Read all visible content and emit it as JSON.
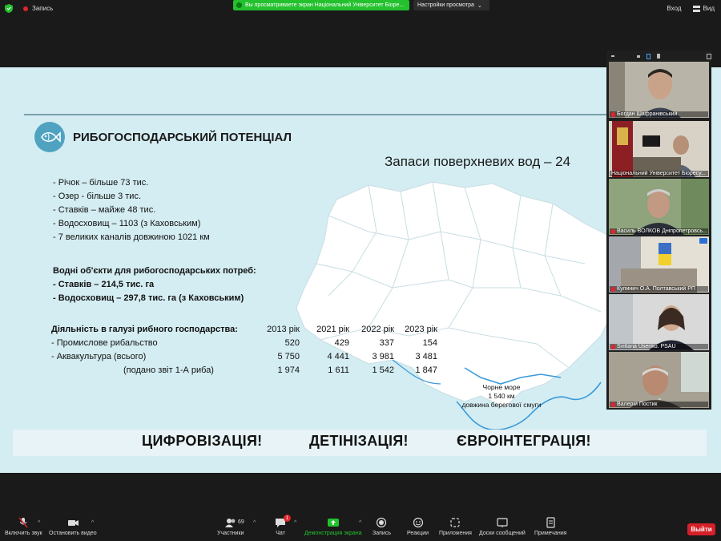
{
  "topbar": {
    "record_label": "Запись",
    "share_banner": "Вы просматриваете экран Національний Університет Біоре...",
    "view_options": "Настройки просмотра",
    "enter_label": "Вход",
    "view_label": "Вид"
  },
  "slide": {
    "title": "РИБОГОСПОДАРСЬКИЙ ПОТЕНЦІАЛ",
    "map_title": "Запаси поверхневих вод – 24",
    "stats": [
      "-  Річок – більше 73 тис.",
      "-  Озер -  більше 3 тис.",
      "-  Ставків – майже 48 тис.",
      "-  Водосховищ – 1103 (з Каховським)",
      "-  7 великих каналів довжиною 1021 км"
    ],
    "water_objects": {
      "heading": "Водні об'єкти для рибогосподарських потреб:",
      "items": [
        "- Ставків – 214,5 тис. га",
        "- Водосховищ – 297,8 тис. га (з Каховським)"
      ]
    },
    "activity": {
      "heading": "Діяльність в галузі рибного господарства:",
      "years": [
        "2013 рік",
        "2021 рік",
        "2022 рік",
        "2023 рік"
      ],
      "rows": [
        {
          "label": "-  Промислове рибальство",
          "values": [
            "520",
            "429",
            "337",
            "154"
          ]
        },
        {
          "label": "- Аквакультура (всього)",
          "values": [
            "5 750",
            "4 441",
            "3 981",
            "3 481"
          ]
        },
        {
          "label": "(подано звіт 1-А риба)",
          "values": [
            "1 974",
            "1 611",
            "1 542",
            "1 847"
          ]
        }
      ]
    },
    "sea_label": {
      "line1": "Чорне море",
      "line2": "1 540 км",
      "line3": "довжина берегової смуги"
    },
    "slogans": [
      "ЦИФРОВІЗАЦІЯ!",
      "ДЕТІНІЗАЦІЯ!",
      "ЄВРОІНТЕГРАЦІЯ!"
    ]
  },
  "participants": [
    {
      "name": "Богдан Шафранівський"
    },
    {
      "name": "Національний Університет Біоресу..."
    },
    {
      "name": "Василь ВОЛКОВ Дніпропетровсь..."
    },
    {
      "name": "Кулинич О.А. Полтавський РП"
    },
    {
      "name": "Svitlana Usenko. PSAU"
    },
    {
      "name": "Валерій Постик"
    }
  ],
  "toolbar": {
    "unmute": "Включить звук",
    "stop_video": "Остановить видео",
    "participants": "Участники",
    "participants_count": "69",
    "chat": "Чат",
    "chat_badge": "1",
    "share_screen": "Демонстрация экрана",
    "record": "Запись",
    "reactions": "Реакции",
    "apps": "Приложения",
    "whiteboards": "Доски сообщений",
    "notes": "Примечания",
    "leave": "Выйти"
  },
  "colors": {
    "slide_bg": "#d4edf2",
    "share_green": "#24c12e",
    "leave_red": "#d5202a",
    "icon_blue": "#4fa3c1"
  }
}
